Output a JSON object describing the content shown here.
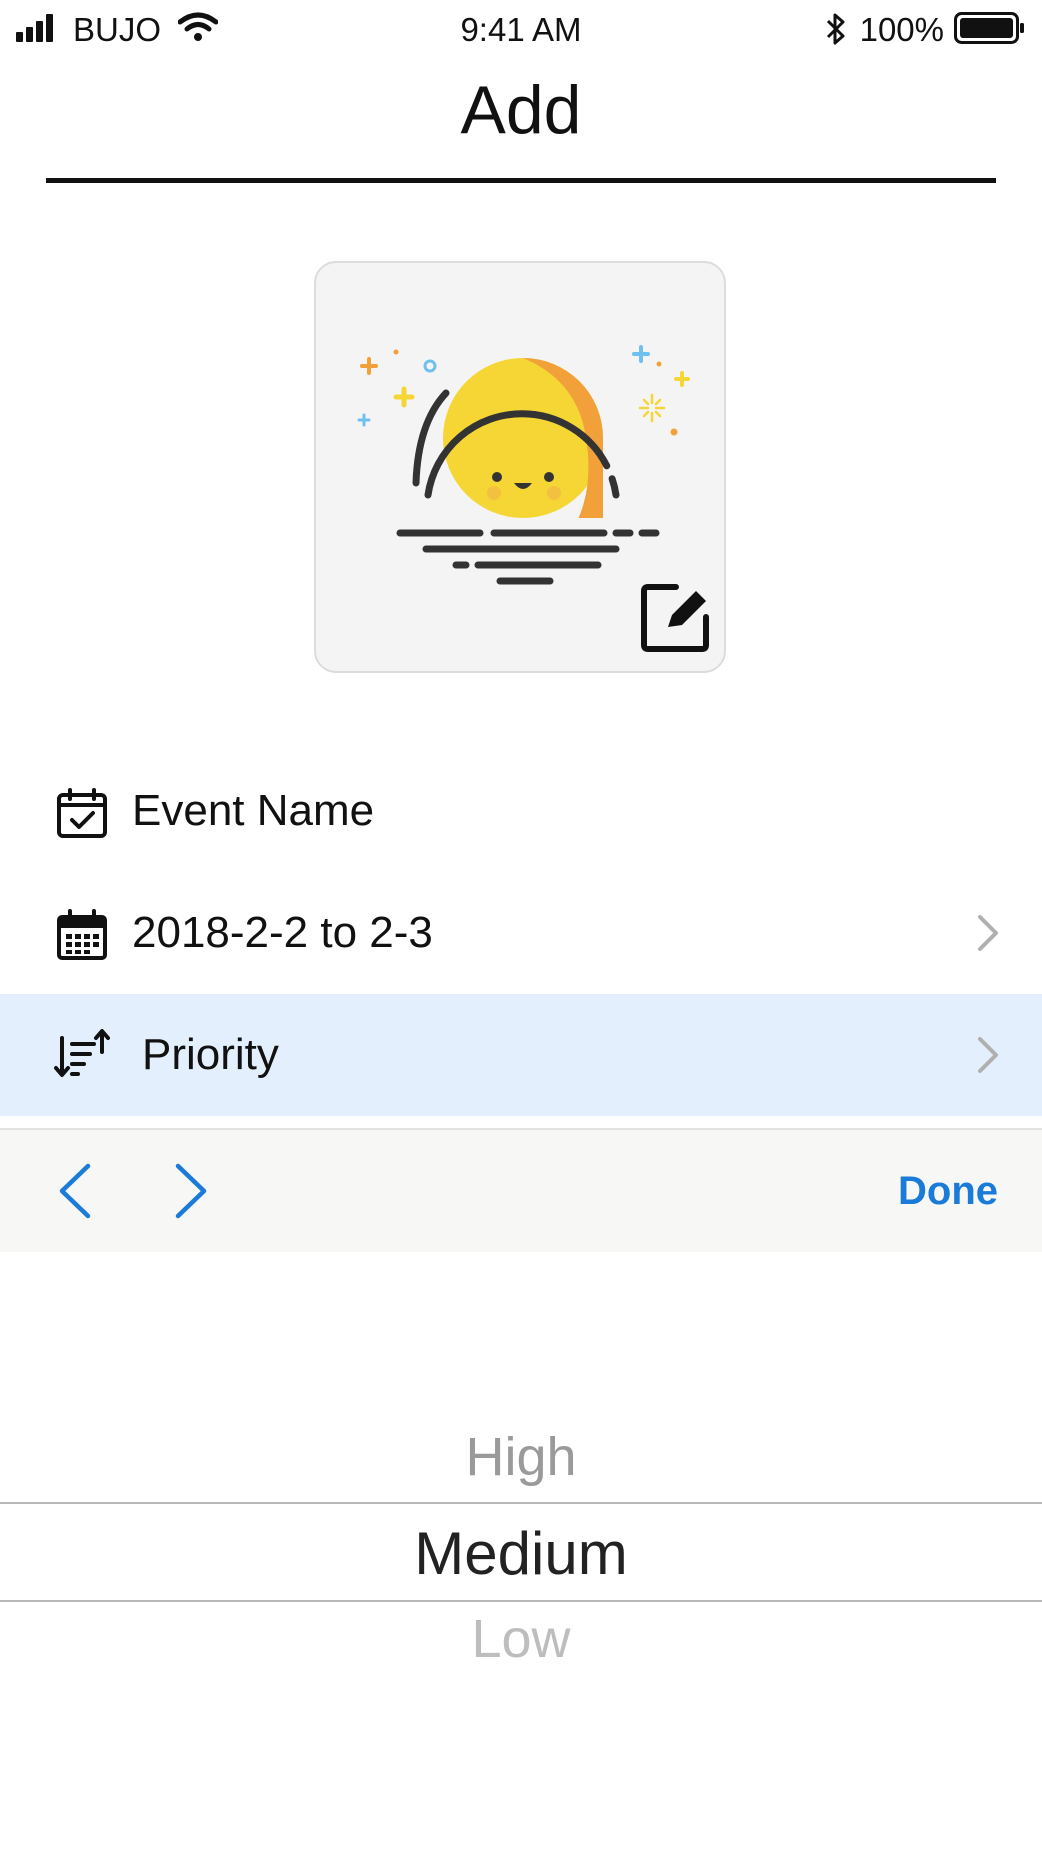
{
  "status_bar": {
    "carrier": "BUJO",
    "time": "9:41 AM",
    "battery": "100%",
    "icons": [
      "signal-icon",
      "wifi-icon",
      "bluetooth-icon",
      "battery-icon"
    ]
  },
  "header": {
    "title": "Add"
  },
  "image_card": {
    "icon": "sunset-illustration",
    "edit_icon": "edit-icon"
  },
  "form": {
    "event_name": {
      "label": "Event Name",
      "icon": "calendar-check-icon"
    },
    "date": {
      "label": "2018-2-2 to 2-3",
      "icon": "calendar-grid-icon"
    },
    "priority": {
      "label": "Priority",
      "icon": "sort-icon"
    }
  },
  "toolbar": {
    "done_label": "Done",
    "prev_icon": "chevron-left-icon",
    "next_icon": "chevron-right-icon"
  },
  "picker": {
    "options": [
      "High",
      "Medium",
      "Low"
    ],
    "selected": "Medium"
  },
  "colors": {
    "accent": "#1a7bd8",
    "selected_row": "#e3effc",
    "sun": "#f5d634",
    "sun_shadow": "#f2a03a"
  }
}
